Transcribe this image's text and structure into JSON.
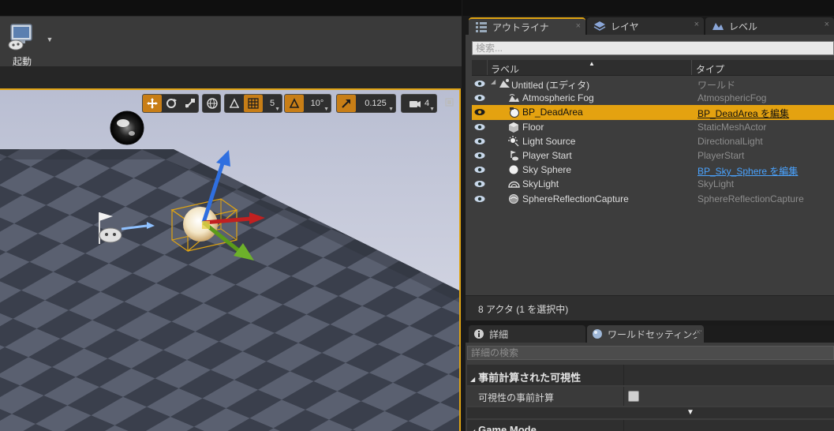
{
  "toolbar": {
    "launch_label": "起動"
  },
  "viewport": {
    "grid_snap_value": "5",
    "rotation_snap_value": "10°",
    "scale_snap_value": "0.125",
    "camera_speed_value": "4"
  },
  "tabs": {
    "outliner": "アウトライナ",
    "layers": "レイヤ",
    "levels": "レベル",
    "close_glyph": "×"
  },
  "outliner": {
    "search_placeholder": "検索...",
    "column_label": "ラベル",
    "column_type": "タイプ",
    "sort_glyph": "▲",
    "rows": [
      {
        "name": "Untitled (エディタ)",
        "type": "ワールド",
        "icon": "world-icon",
        "selected": false
      },
      {
        "name": "Atmospheric Fog",
        "type": "AtmosphericFog",
        "icon": "fog-icon",
        "selected": false
      },
      {
        "name": "BP_DeadArea",
        "type": "BP_DeadArea を編集",
        "icon": "blueprint-sphere-icon",
        "selected": true
      },
      {
        "name": "Floor",
        "type": "StaticMeshActor",
        "icon": "static-mesh-icon",
        "selected": false
      },
      {
        "name": "Light Source",
        "type": "DirectionalLight",
        "icon": "directional-light-icon",
        "selected": false
      },
      {
        "name": "Player Start",
        "type": "PlayerStart",
        "icon": "player-start-icon",
        "selected": false
      },
      {
        "name": "Sky Sphere",
        "type": "BP_Sky_Sphere を編集",
        "icon": "sky-sphere-icon",
        "selected": false
      },
      {
        "name": "SkyLight",
        "type": "SkyLight",
        "icon": "skylight-icon",
        "selected": false
      },
      {
        "name": "SphereReflectionCapture",
        "type": "SphereReflectionCapture",
        "icon": "reflection-capture-icon",
        "selected": false
      }
    ],
    "footer": "8 アクタ (1 を選択中)"
  },
  "details": {
    "tab_details": "詳細",
    "tab_world_settings": "ワールドセッティング",
    "search_placeholder": "詳細の検索",
    "category_precomputed": "事前計算された可視性",
    "prop_precompute_visibility": "可視性の事前計算",
    "category_game_mode": "Game Mode",
    "expand_glyph": "▼",
    "collapse_glyph": "◢"
  },
  "colors": {
    "accent": "#e0a412",
    "selection": "#e4a210",
    "link": "#4aa3ff",
    "panel": "#3d3d3d"
  }
}
